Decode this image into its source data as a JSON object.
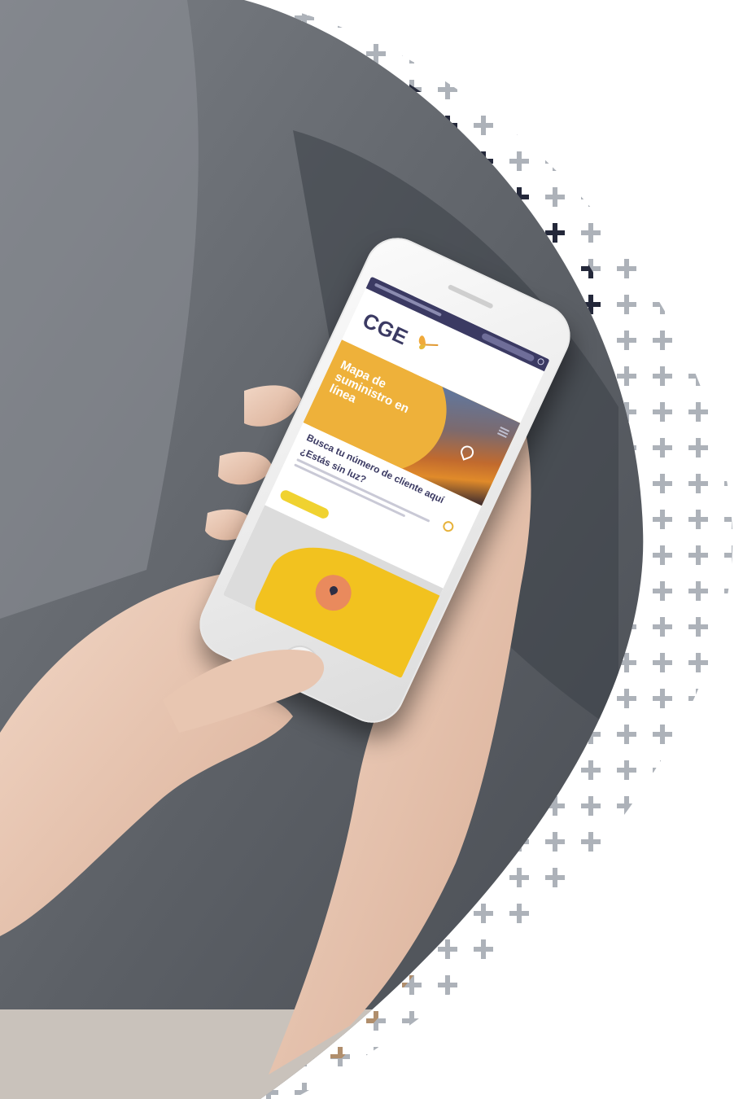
{
  "scene": {
    "description_type": "photo-advertisement",
    "colors": {
      "background": "#ffffff",
      "jeans": "#6a6e73",
      "skin": "#e9c8b4",
      "plus_dark": "#24283a",
      "plus_gray": "#9ea4ad",
      "plus_tan": "#b08a63"
    }
  },
  "app": {
    "brand": "CGE",
    "hero_title": "Mapa de suministro en línea",
    "search_heading": "Busca tu número de cliente aquí",
    "outage_question": "¿Estás sin luz?",
    "icons": [
      "search-icon",
      "map-pin-icon",
      "menu-icon",
      "butterfly-logo-icon"
    ],
    "colors": {
      "navy": "#3b3a63",
      "orange": "#e9a930",
      "yellow": "#f2c21f",
      "coral": "#e98a5d"
    }
  }
}
